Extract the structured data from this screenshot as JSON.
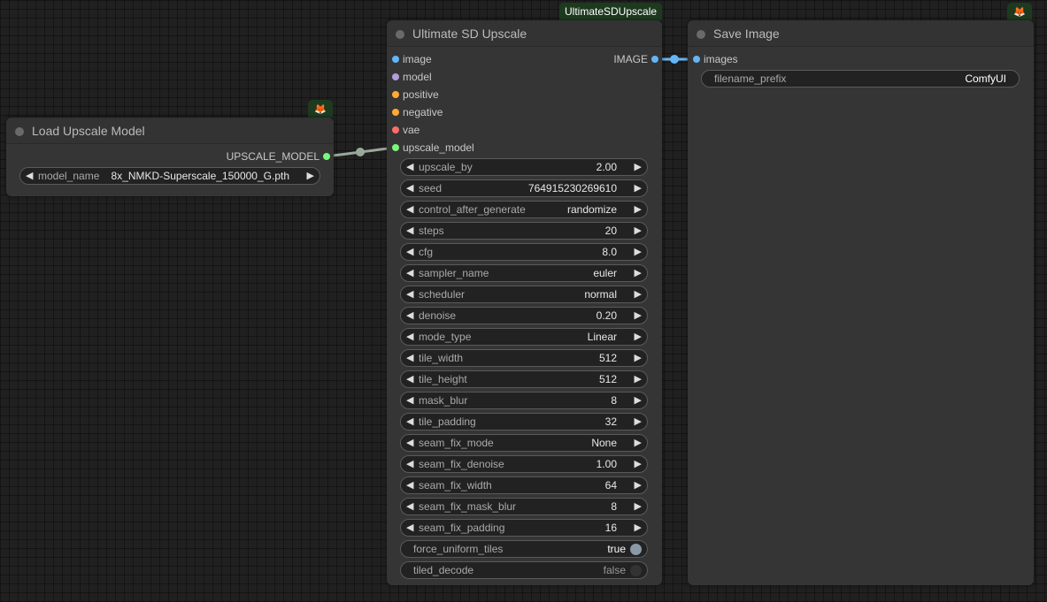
{
  "colors": {
    "image": "#64b5f6",
    "model": "#b39ddb",
    "conditioning": "#ffa931",
    "vae": "#ff6e6e",
    "upscale_model": "#7cf57c",
    "link_upscale": "#9aa89a",
    "link_image": "#64b5f6",
    "badge": "#1d3a1f"
  },
  "load_upscale": {
    "title": "Load Upscale Model",
    "output_label": "UPSCALE_MODEL",
    "widget": {
      "name": "model_name",
      "value": "8x_NMKD-Superscale_150000_G.pth"
    },
    "badge_icon": "fox-icon"
  },
  "ultimate": {
    "badge": "UltimateSDUpscale",
    "title": "Ultimate SD Upscale",
    "output_label": "IMAGE",
    "inputs": [
      {
        "label": "image",
        "color": "#64b5f6"
      },
      {
        "label": "model",
        "color": "#b39ddb"
      },
      {
        "label": "positive",
        "color": "#ffa931"
      },
      {
        "label": "negative",
        "color": "#ffa931"
      },
      {
        "label": "vae",
        "color": "#ff6e6e"
      },
      {
        "label": "upscale_model",
        "color": "#7cf57c"
      }
    ],
    "widgets": [
      {
        "name": "upscale_by",
        "value": "2.00"
      },
      {
        "name": "seed",
        "value": "764915230269610"
      },
      {
        "name": "control_after_generate",
        "value": "randomize"
      },
      {
        "name": "steps",
        "value": "20"
      },
      {
        "name": "cfg",
        "value": "8.0"
      },
      {
        "name": "sampler_name",
        "value": "euler"
      },
      {
        "name": "scheduler",
        "value": "normal"
      },
      {
        "name": "denoise",
        "value": "0.20"
      },
      {
        "name": "mode_type",
        "value": "Linear"
      },
      {
        "name": "tile_width",
        "value": "512"
      },
      {
        "name": "tile_height",
        "value": "512"
      },
      {
        "name": "mask_blur",
        "value": "8"
      },
      {
        "name": "tile_padding",
        "value": "32"
      },
      {
        "name": "seam_fix_mode",
        "value": "None"
      },
      {
        "name": "seam_fix_denoise",
        "value": "1.00"
      },
      {
        "name": "seam_fix_width",
        "value": "64"
      },
      {
        "name": "seam_fix_mask_blur",
        "value": "8"
      },
      {
        "name": "seam_fix_padding",
        "value": "16"
      }
    ],
    "toggles": [
      {
        "name": "force_uniform_tiles",
        "value": "true",
        "on": true
      },
      {
        "name": "tiled_decode",
        "value": "false",
        "on": false
      }
    ]
  },
  "save_image": {
    "title": "Save Image",
    "input_label": "images",
    "widget": {
      "name": "filename_prefix",
      "value": "ComfyUI"
    },
    "badge_icon": "fox-icon"
  }
}
